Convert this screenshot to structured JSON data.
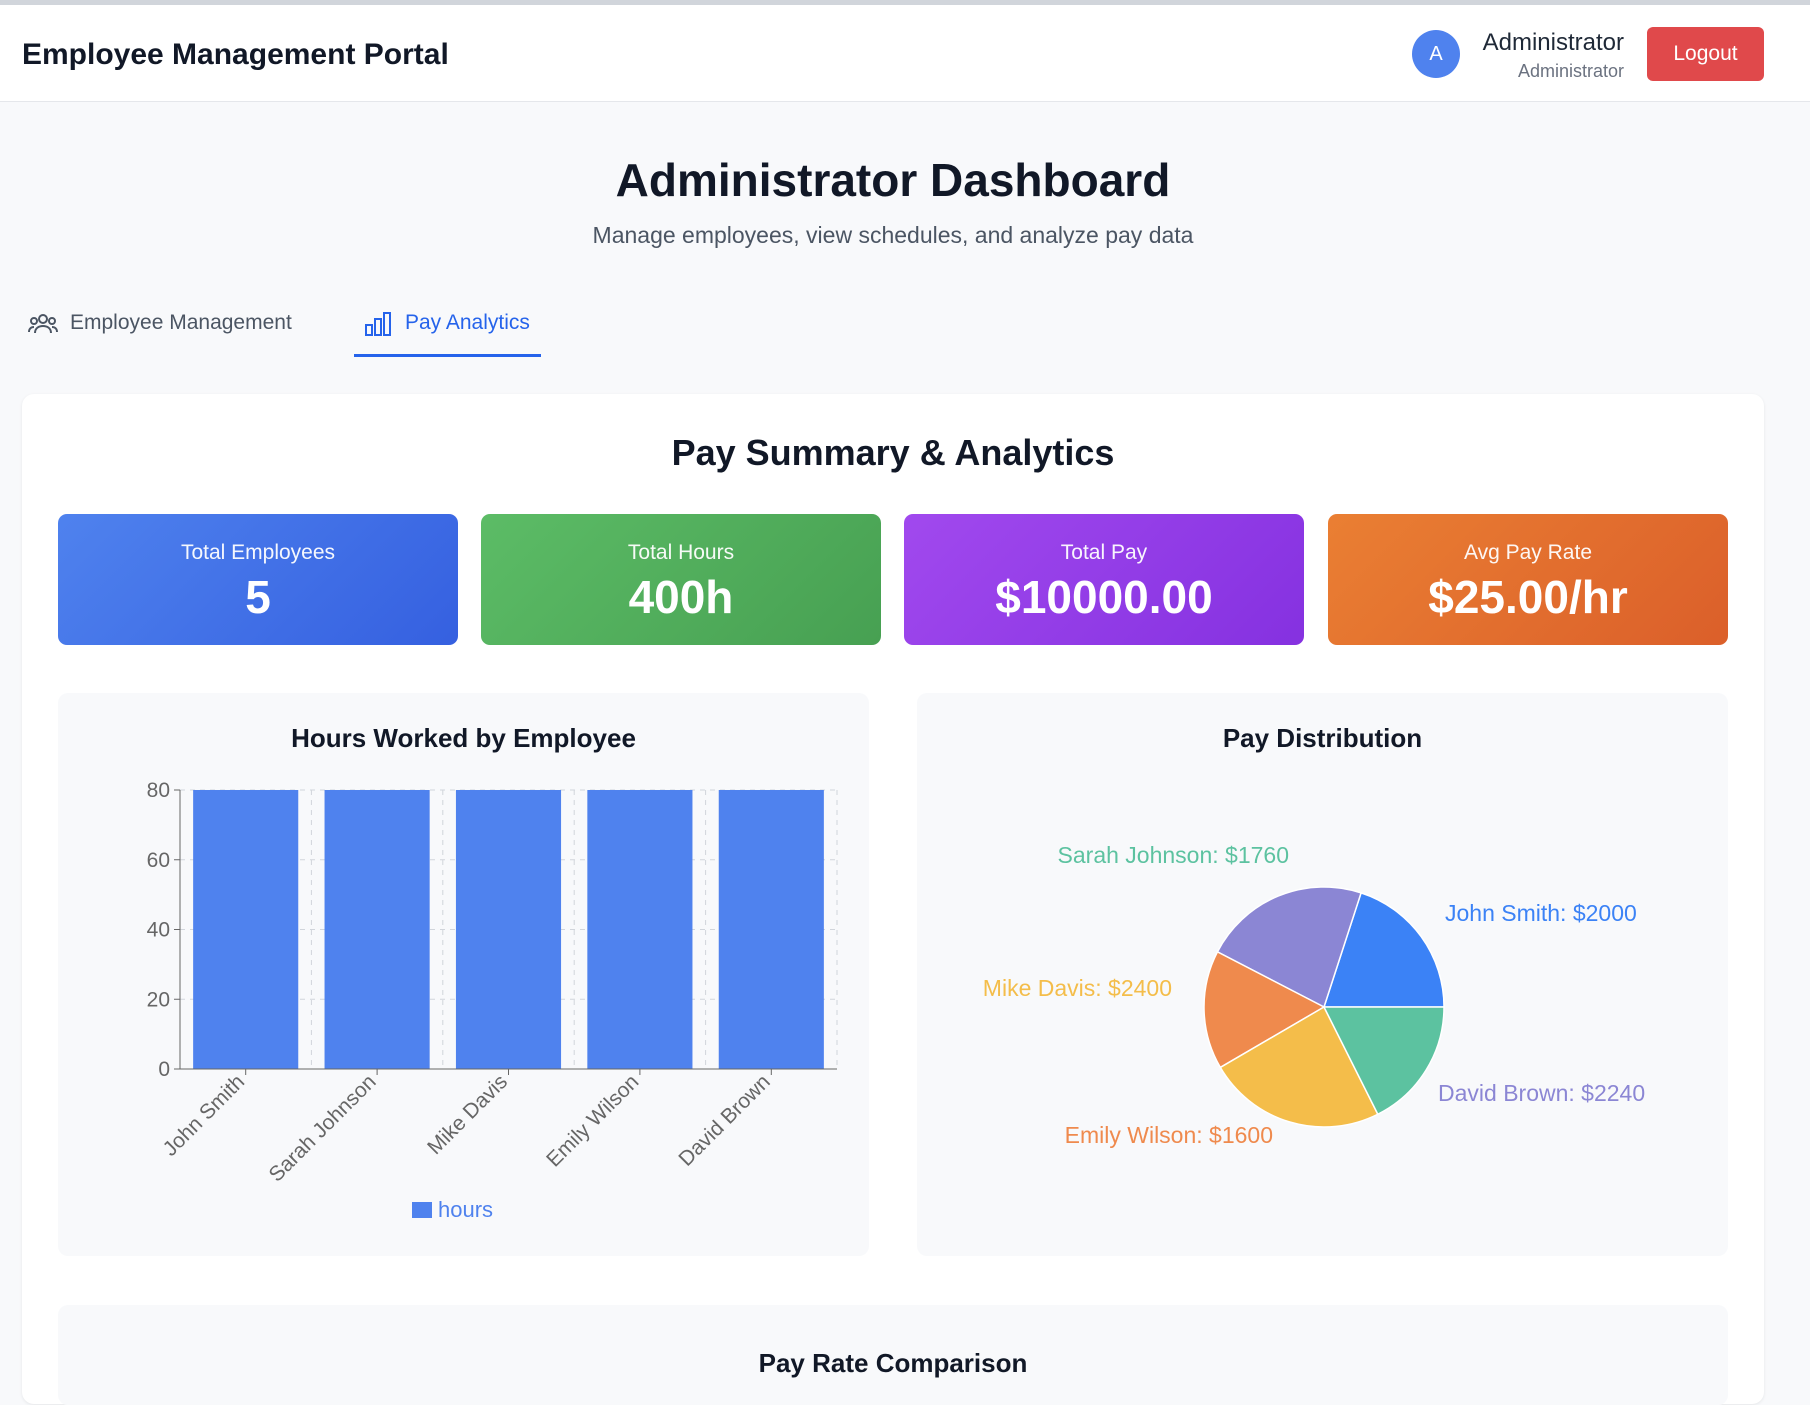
{
  "header": {
    "brand": "Employee Management Portal",
    "avatar_initial": "A",
    "user_name": "Administrator",
    "user_role": "Administrator",
    "logout_label": "Logout"
  },
  "page": {
    "title": "Administrator Dashboard",
    "subtitle": "Manage employees, view schedules, and analyze pay data"
  },
  "tabs": [
    {
      "label": "Employee Management",
      "icon": "users-icon",
      "active": false
    },
    {
      "label": "Pay Analytics",
      "icon": "bar-chart-icon",
      "active": true
    }
  ],
  "summary": {
    "title": "Pay Summary & Analytics",
    "stats": [
      {
        "label": "Total Employees",
        "value": "5"
      },
      {
        "label": "Total Hours",
        "value": "400h"
      },
      {
        "label": "Total Pay",
        "value": "$10000.00"
      },
      {
        "label": "Avg Pay Rate",
        "value": "$25.00/hr"
      }
    ]
  },
  "panels": {
    "bar_title": "Hours Worked by Employee",
    "pie_title": "Pay Distribution",
    "bottom_title": "Pay Rate Comparison"
  },
  "colors": {
    "bar": "#4f82ee",
    "pie": [
      "#3b82f6",
      "#8b86d4",
      "#ef8a4d",
      "#f4bd4a",
      "#5cc2a0"
    ]
  },
  "chart_data": [
    {
      "type": "bar",
      "title": "Hours Worked by Employee",
      "categories": [
        "John Smith",
        "Sarah Johnson",
        "Mike Davis",
        "Emily Wilson",
        "David Brown"
      ],
      "series": [
        {
          "name": "hours",
          "values": [
            80,
            80,
            80,
            80,
            80
          ]
        }
      ],
      "ylim": [
        0,
        80
      ],
      "yticks": [
        0,
        20,
        40,
        60,
        80
      ],
      "grid": true,
      "legend": "bottom"
    },
    {
      "type": "pie",
      "title": "Pay Distribution",
      "labels": [
        "John Smith",
        "David Brown",
        "Emily Wilson",
        "Mike Davis",
        "Sarah Johnson"
      ],
      "values": [
        2000,
        2240,
        1600,
        2400,
        1760
      ],
      "slice_labels": [
        "John Smith: $2000",
        "David Brown: $2240",
        "Emily Wilson: $1600",
        "Mike Davis: $2400",
        "Sarah Johnson: $1760"
      ]
    }
  ]
}
